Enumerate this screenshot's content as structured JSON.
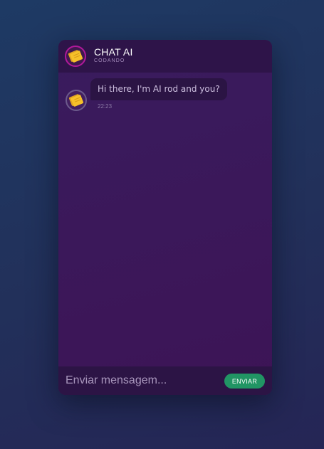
{
  "header": {
    "title": "CHAT AI",
    "subtitle": "CODANDO",
    "avatar_icon": "sticky-note-icon"
  },
  "messages": [
    {
      "sender": "bot",
      "avatar_icon": "sticky-note-icon",
      "text": "Hi there, I'm AI rod and you?",
      "time": "22:23"
    }
  ],
  "composer": {
    "placeholder": "Enviar mensagem...",
    "value": "",
    "send_label": "ENVIAR"
  },
  "colors": {
    "brand_accent": "#b1199b",
    "send_button": "#219564",
    "window_bg": "#391c5e",
    "header_bg": "#2e1449",
    "note_yellow": "#f6c12a"
  }
}
